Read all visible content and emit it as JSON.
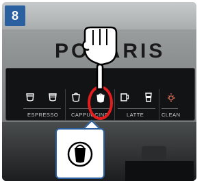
{
  "step": {
    "number": "8"
  },
  "brand": {
    "text": "POLARIS"
  },
  "panel": {
    "labels": {
      "espresso": "ESPRESSO",
      "cappuccino": "CAPPUCCINO",
      "latte": "LATTE",
      "clean": "CLEAN"
    },
    "buttons": [
      {
        "name": "espresso-single-cup-icon"
      },
      {
        "name": "espresso-double-cup-icon"
      },
      {
        "name": "cappuccino-single-cup-icon"
      },
      {
        "name": "cappuccino-double-cup-icon"
      },
      {
        "name": "latte-mug-icon"
      },
      {
        "name": "latte-glass-icon"
      },
      {
        "name": "clean-sparkle-icon"
      }
    ]
  },
  "colors": {
    "badge": "#2a5fa0",
    "highlight": "#e21d1d",
    "icon_white": "#ffffff",
    "clean_accent": "#e0705a"
  }
}
